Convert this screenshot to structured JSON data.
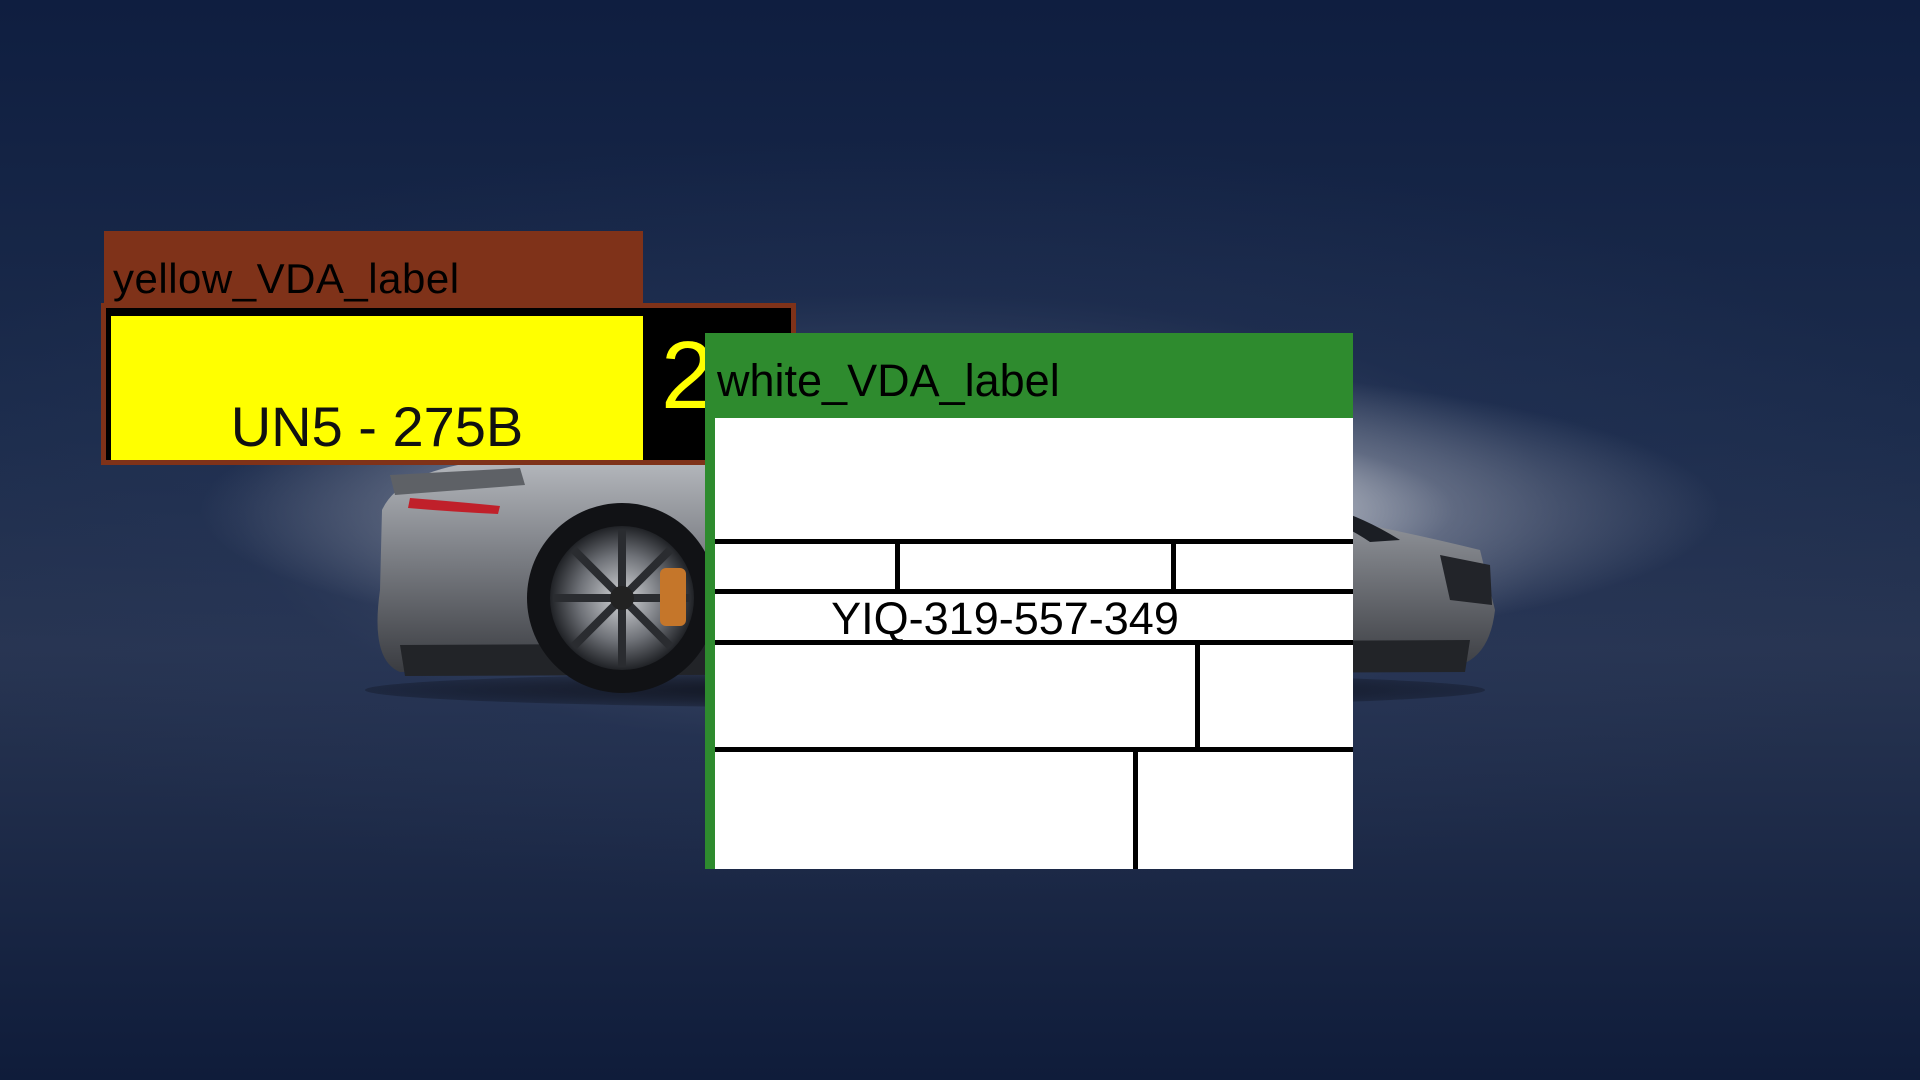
{
  "scene": {
    "background_colors": {
      "sky": "#0f1e40",
      "floor_light": "#ffffff"
    },
    "car_color": "#6c6f74"
  },
  "yellow_label": {
    "tag": "yellow_VDA_label",
    "tag_color": "#7f3219",
    "code": "UN5 - 275B",
    "count": "2",
    "fill_color": "#ffff00"
  },
  "white_label": {
    "tag": "white_VDA_label",
    "tag_color": "#2e8b2e",
    "id": "YIQ-319-557-349"
  }
}
